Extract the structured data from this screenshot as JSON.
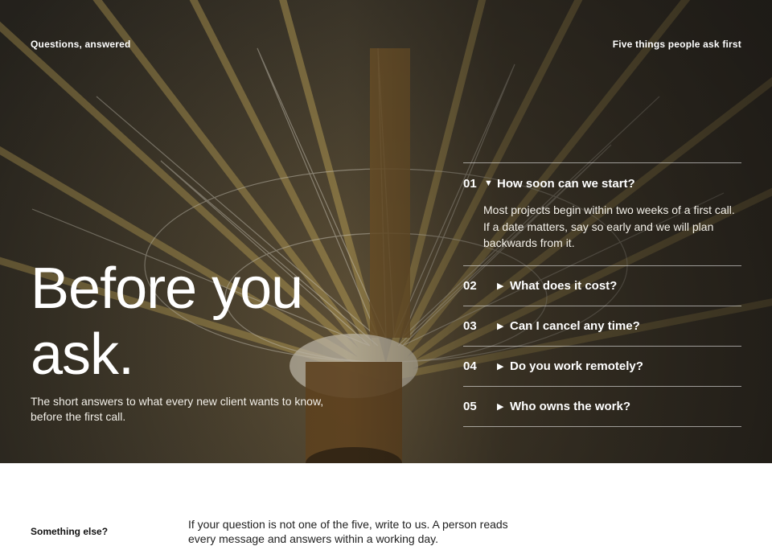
{
  "header": {
    "eyebrow_left": "Questions, answered",
    "eyebrow_right": "Five things people ask first"
  },
  "hero": {
    "headline_line1": "Before you",
    "headline_line2": "ask.",
    "subhead": "The short answers to what every new client wants to know, before the first call.",
    "background": "photo of a paper parasol seen from underneath, yellow ribs and white threads"
  },
  "faq": {
    "items": [
      {
        "num": "01",
        "icon": "triangle-down-icon",
        "question": "How soon can we start?",
        "answer": "Most projects begin within two weeks of a first call. If a date matters, say so early and we will plan backwards from it.",
        "open": true
      },
      {
        "num": "02",
        "icon": "triangle-right-icon",
        "question": "What does it cost?",
        "open": false
      },
      {
        "num": "03",
        "icon": "triangle-right-icon",
        "question": "Can I cancel any time?",
        "open": false
      },
      {
        "num": "04",
        "icon": "triangle-right-icon",
        "question": "Do you work remotely?",
        "open": false
      },
      {
        "num": "05",
        "icon": "triangle-right-icon",
        "question": "Who owns the work?",
        "open": false
      }
    ]
  },
  "footer": {
    "label": "Something else?",
    "text": "If your question is not one of the five, write to us. A person reads every message and answers within a working day."
  },
  "colors": {
    "text_on_image": "#ffffff",
    "rule": "#ffffff",
    "page_background": "#ffffff"
  }
}
